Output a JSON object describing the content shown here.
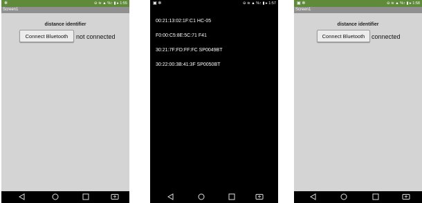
{
  "screens": [
    {
      "id": "p1",
      "status_left": "✻",
      "status_right": "⊖ ≋ ▲ %↑ ▮ ▸ 1:55",
      "title": "Screen1",
      "heading": "distance identifier",
      "button_label": "Connect Bluetooth",
      "status_text": "not connected"
    },
    {
      "id": "p2",
      "status_left": "▣ ✻",
      "status_right": "⊖ ≋ ▲ %↑ ▮ ▸ 1:57",
      "devices": [
        "00:21:13:02:1F:C1 HC-05",
        "F0:00:C5:8E:5C:71 F41",
        "30:21:7F:FD:FF:FC SP0049BT",
        "30:22:00:3B:41:3F SP0050BT"
      ]
    },
    {
      "id": "p3",
      "status_left": "▣ ✻",
      "status_right": "⊖ ≋ ▲ %↑ ▮ ▸ 1:58",
      "title": "Screen1",
      "heading": "distance identifier",
      "button_label": "Connect Bluetooth",
      "status_text": "connected"
    }
  ],
  "navbar": {
    "icons": [
      "back-icon",
      "home-icon",
      "recents-icon",
      "screen-mirror-icon"
    ],
    "icon_color": "#e0e0e0"
  },
  "colors": {
    "status_bar": "#5f8a3a",
    "title_bar": "#909090",
    "app_background": "#d4d4d4",
    "picker_background": "#000000"
  }
}
